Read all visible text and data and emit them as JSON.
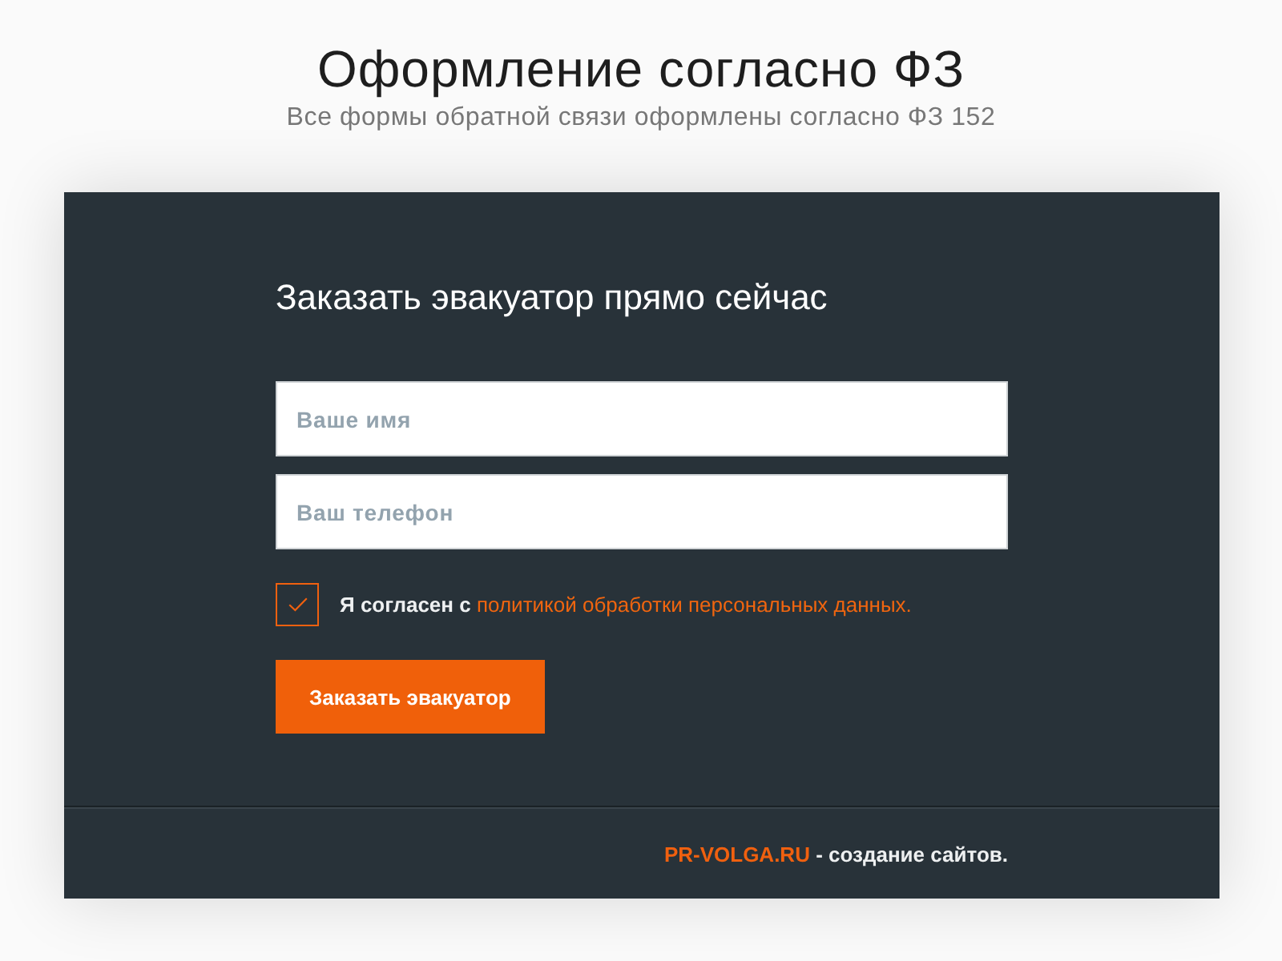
{
  "header": {
    "title": "Оформление согласно ФЗ",
    "subtitle": "Все формы обратной связи оформлены согласно ФЗ 152"
  },
  "form": {
    "title": "Заказать эвакуатор прямо сейчас",
    "fields": [
      {
        "placeholder": "Ваше имя"
      },
      {
        "placeholder": "Ваш телефон"
      }
    ],
    "consent": {
      "checked": true,
      "text": "Я согласен с",
      "link": "политикой обработки персональных данных."
    },
    "submit": "Заказать эвакуатор"
  },
  "footer": {
    "brand": "PR-VOLGA.RU",
    "text": "- создание сайтов."
  }
}
